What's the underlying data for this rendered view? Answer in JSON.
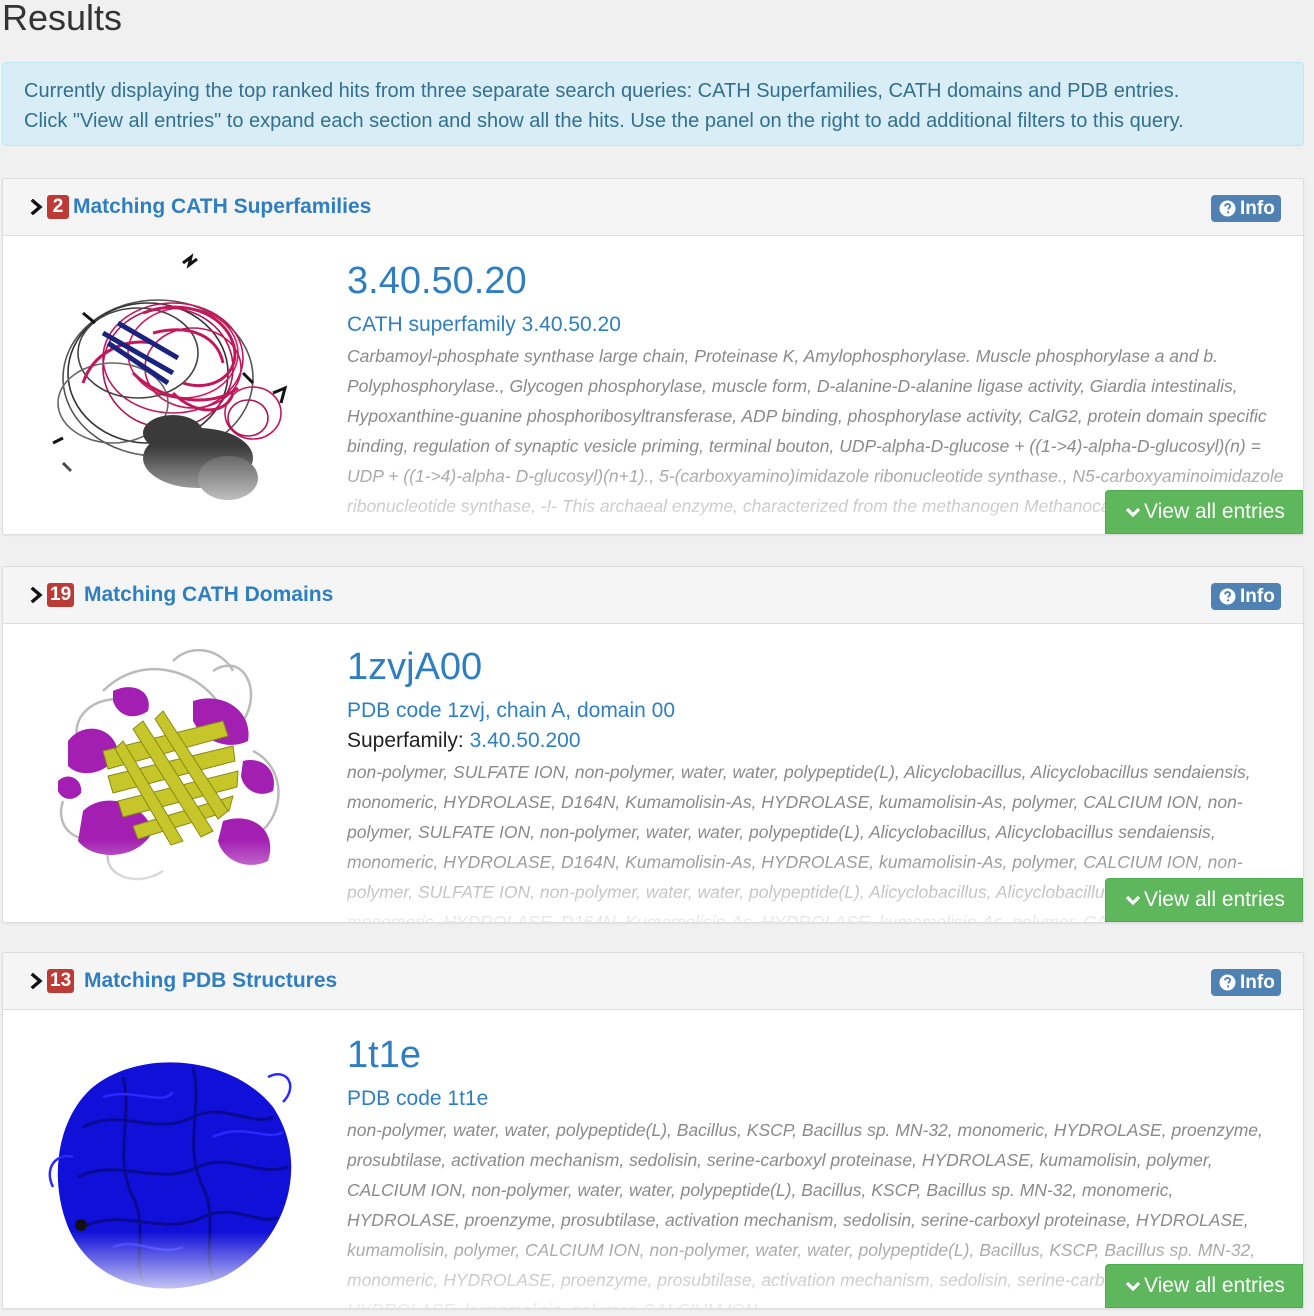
{
  "page": {
    "title": "Results"
  },
  "alert": {
    "line1": "Currently displaying the top ranked hits from three separate search queries: CATH Superfamilies, CATH domains and PDB entries.",
    "line2": "Click \"View all entries\" to expand each section and show all the hits. Use the panel on the right to add additional filters to this query."
  },
  "colors": {
    "link": "#2f7fc0",
    "badge": "#bd3b36",
    "info_button": "#4f82b3",
    "view_all_button": "#5eb65d",
    "alert_bg": "#d9edf7",
    "alert_text": "#31708f"
  },
  "sections": [
    {
      "count": "2",
      "title": "Matching CATH Superfamilies",
      "info_label": "Info",
      "info_icon": "question-circle-icon",
      "hit": {
        "id": "3.40.50.20",
        "subtitle": "CATH superfamily 3.40.50.20",
        "description": "Carbamoyl-phosphate synthase large chain, Proteinase K, Amylophosphorylase. Muscle phosphorylase a and b. Polyphosphorylase., Glycogen phosphorylase, muscle form, D-alanine-D-alanine ligase activity, Giardia intestinalis, Hypoxanthine-guanine phosphoribosyltransferase, ADP binding, phosphorylase activity, CalG2, protein domain specific binding, regulation of synaptic vesicle priming, terminal bouton, UDP-alpha-D-glucose + ((1->4)-alpha-D-glucosyl)(n) = UDP + ((1->4)-alpha- D-glucosyl)(n+1)., 5-(carboxyamino)imidazole ribonucleotide synthase., N5-carboxyaminoimidazole ribonucleotide synthase, -!- This archaeal enzyme, characterized from the methanogen Methanocaldococcus jannaschii, ..."
      },
      "view_all_label": "View all entries"
    },
    {
      "count": "19",
      "title": "Matching CATH Domains",
      "info_label": "Info",
      "info_icon": "question-circle-icon",
      "hit": {
        "id": "1zvjA00",
        "subtitle": "PDB code 1zvj, chain A, domain 00",
        "superfamily_label": "Superfamily:",
        "superfamily_value": "3.40.50.200",
        "description": "non-polymer, SULFATE ION, non-polymer, water, water, polypeptide(L), Alicyclobacillus, Alicyclobacillus sendaiensis, monomeric, HYDROLASE, D164N, Kumamolisin-As, HYDROLASE, kumamolisin-As, polymer, CALCIUM ION, non-polymer, SULFATE ION, non-polymer, water, water, polypeptide(L), Alicyclobacillus, Alicyclobacillus sendaiensis, monomeric, HYDROLASE, D164N, Kumamolisin-As, HYDROLASE, kumamolisin-As, polymer, CALCIUM ION, non-polymer, SULFATE ION, non-polymer, water, water, polypeptide(L), Alicyclobacillus, Alicyclobacillus sendaiensis, monomeric, HYDROLASE, D164N, Kumamolisin-As, HYDROLASE, kumamolisin-As, polymer, CALCIUM ION, non-polymer, SULFATE ION, non-polymer"
      },
      "view_all_label": "View all entries"
    },
    {
      "count": "13",
      "title": "Matching PDB Structures",
      "info_label": "Info",
      "info_icon": "question-circle-icon",
      "hit": {
        "id": "1t1e",
        "subtitle": "PDB code 1t1e",
        "description": "non-polymer, water, water, polypeptide(L), Bacillus, KSCP, Bacillus sp. MN-32, monomeric, HYDROLASE, proenzyme, prosubtilase, activation mechanism, sedolisin, serine-carboxyl proteinase, HYDROLASE, kumamolisin, polymer, CALCIUM ION, non-polymer, water, water, polypeptide(L), Bacillus, KSCP, Bacillus sp. MN-32, monomeric, HYDROLASE, proenzyme, prosubtilase, activation mechanism, sedolisin, serine-carboxyl proteinase, HYDROLASE, kumamolisin, polymer, CALCIUM ION, non-polymer, water, water, polypeptide(L), Bacillus, KSCP, Bacillus sp. MN-32, monomeric, HYDROLASE, proenzyme, prosubtilase, activation mechanism, sedolisin, serine-carboxyl proteinase, HYDROLASE, kumamolisin, polymer, CALCIUM ION"
      },
      "view_all_label": "View all entries"
    }
  ]
}
